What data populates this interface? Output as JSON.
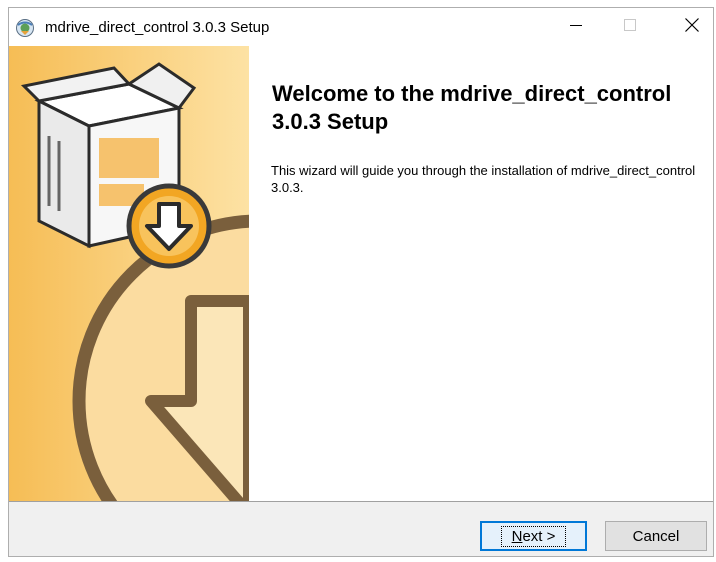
{
  "window": {
    "title": "mdrive_direct_control 3.0.3 Setup",
    "controls": {
      "minimize_icon": "minimize-icon",
      "maximize_icon": "maximize-icon",
      "close_icon": "close-icon"
    }
  },
  "welcome": {
    "heading": "Welcome to the mdrive_direct_control 3.0.3 Setup",
    "body": "This wizard will guide you through the installation of mdrive_direct_control 3.0.3."
  },
  "footer": {
    "next_label_first": "N",
    "next_label_rest": "ext >",
    "cancel_label": "Cancel"
  },
  "colors": {
    "panel_light": "#fde2a4",
    "panel_dark": "#f6bd55",
    "arrow_outline": "#7a5f3c",
    "accent": "#0078d7"
  }
}
